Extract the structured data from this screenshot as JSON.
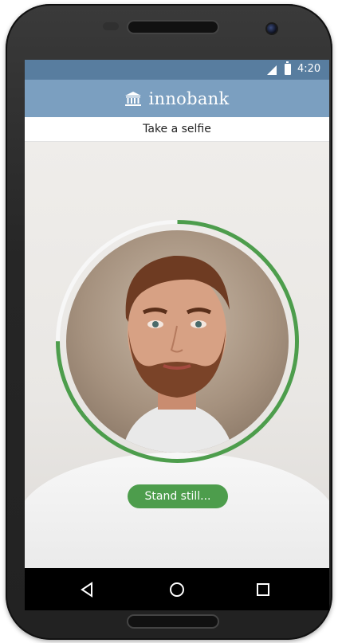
{
  "status_bar": {
    "time": "4:20",
    "signal_icon": "signal-icon",
    "battery_icon": "battery-charging-icon"
  },
  "app_bar": {
    "brand": "innobank",
    "logo_icon": "bank-icon",
    "background": "#7b9fc0"
  },
  "title_bar": {
    "title": "Take a selfie"
  },
  "camera": {
    "status_label": "Stand still...",
    "progress": 0.75,
    "ring_color": "#4d9d4c"
  },
  "nav_bar": {
    "back_icon": "back-icon",
    "home_icon": "home-icon",
    "recents_icon": "recents-icon"
  }
}
